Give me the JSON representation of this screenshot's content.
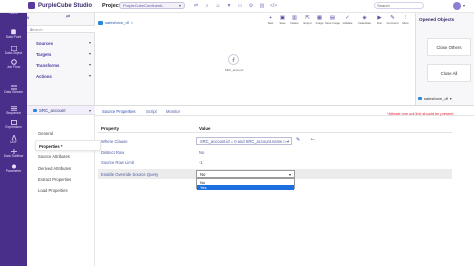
{
  "header": {
    "app_title": "PurpleCube Studio",
    "project_label": "Project",
    "project_value": "PurpleCubeConfluenti...",
    "search_placeholder": "Search"
  },
  "rail": [
    {
      "label": "Home",
      "icon": "home-icon"
    },
    {
      "label": "Data Point",
      "icon": "data-point-icon"
    },
    {
      "label": "Data Object",
      "icon": "data-object-icon"
    },
    {
      "label": "Job Flow",
      "icon": "job-flow-icon"
    },
    {
      "label": "Data Stream",
      "icon": "data-stream-icon"
    },
    {
      "label": "Sequence",
      "icon": "sequence-icon"
    },
    {
      "label": "Expression",
      "icon": "expression-icon"
    },
    {
      "label": "UDF",
      "icon": "udf-icon"
    },
    {
      "label": "Data Subflow",
      "icon": "data-subflow-icon"
    },
    {
      "label": "Parameter",
      "icon": "parameter-icon"
    }
  ],
  "data_panel": {
    "title": "Data Flow",
    "search_placeholder": "Search",
    "sections": [
      "Sources",
      "Targets",
      "Transforms",
      "Actions"
    ]
  },
  "toolbar": {
    "tab_label": "salesforce_df",
    "tools": [
      "New",
      "Save",
      "Delete",
      "Export",
      "Image",
      "Save Image",
      "Validate",
      "Instantiate",
      "Run",
      "Comment",
      "More"
    ]
  },
  "right_panel": {
    "title": "Opened Objects",
    "close_others": "Close Others",
    "close_all": "Close All"
  },
  "canvas": {
    "node_label": "SRC_account",
    "footer_label": "salesforce_df"
  },
  "bottom": {
    "source_tab": "SRC_account",
    "side_items": [
      "General",
      "Properties *",
      "Source Attributes",
      "Derived Attributes",
      "Extract Properties",
      "Load Properties"
    ],
    "sub_tabs": [
      "Source Properties",
      "Script",
      "Monitor"
    ],
    "warning": "*Atleast one out link should be present",
    "grid": {
      "col_property": "Property",
      "col_value": "Value",
      "rows": [
        {
          "property": "Where Clause",
          "value": "SRC_account.id = 0 and SRC_account.name != '"
        },
        {
          "property": "Distinct Row",
          "value": "No"
        },
        {
          "property": "Source Row Limit",
          "value": "-1"
        },
        {
          "property": "Enable Override Source Query",
          "value": "No"
        }
      ]
    },
    "dropdown_options": [
      "No",
      "Yes"
    ]
  },
  "colors": {
    "rail": "#4a2f8a",
    "accent": "#5a3aa0",
    "selected_option": "#1e6fe0",
    "warning": "#e0203a"
  }
}
